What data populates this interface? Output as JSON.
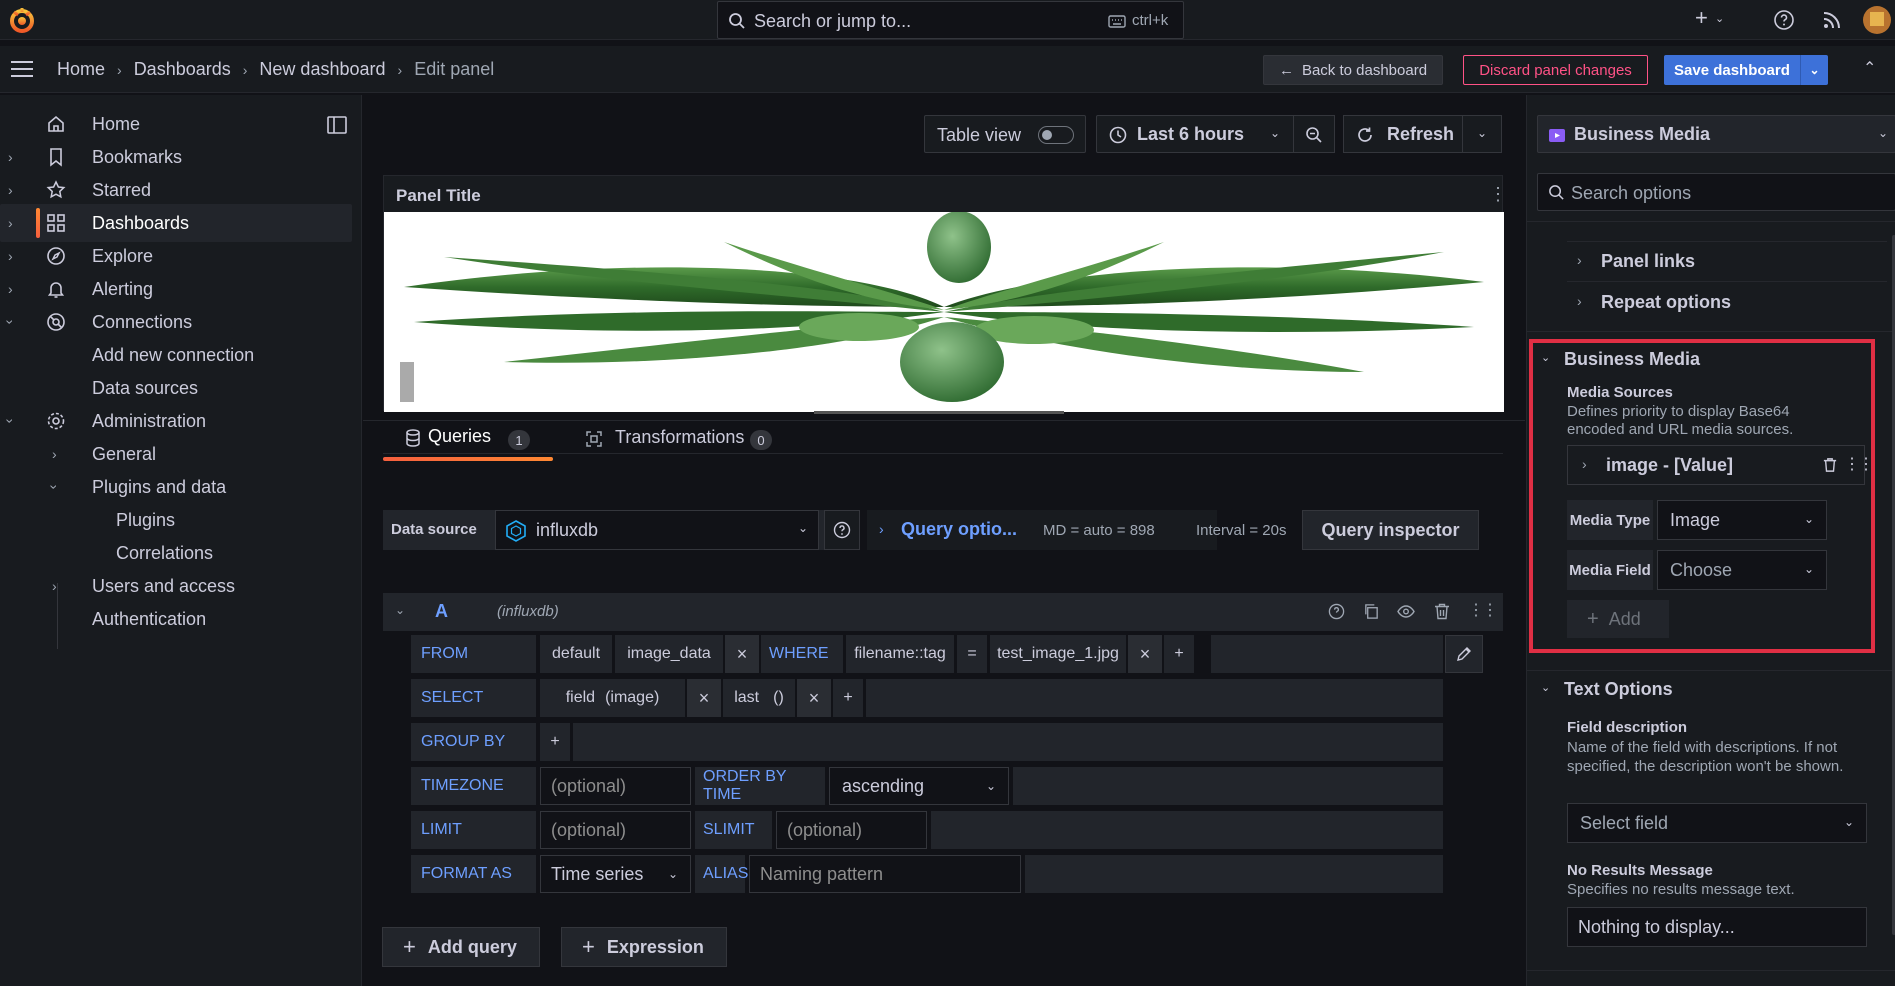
{
  "topbar": {
    "search_placeholder": "Search or jump to...",
    "search_shortcut": "ctrl+k"
  },
  "breadcrumb": {
    "items": [
      "Home",
      "Dashboards",
      "New dashboard",
      "Edit panel"
    ]
  },
  "actions": {
    "back": "Back to dashboard",
    "discard": "Discard panel changes",
    "save": "Save dashboard"
  },
  "sidebar": {
    "items": [
      {
        "label": "Home"
      },
      {
        "label": "Bookmarks"
      },
      {
        "label": "Starred"
      },
      {
        "label": "Dashboards"
      },
      {
        "label": "Explore"
      },
      {
        "label": "Alerting"
      },
      {
        "label": "Connections"
      },
      {
        "label": "Add new connection"
      },
      {
        "label": "Data sources"
      },
      {
        "label": "Administration"
      },
      {
        "label": "General"
      },
      {
        "label": "Plugins and data"
      },
      {
        "label": "Plugins"
      },
      {
        "label": "Correlations"
      },
      {
        "label": "Users and access"
      },
      {
        "label": "Authentication"
      }
    ]
  },
  "toolbar": {
    "table_view": "Table view",
    "time_range": "Last 6 hours",
    "refresh": "Refresh"
  },
  "panel": {
    "title": "Panel Title"
  },
  "tabs": {
    "queries": "Queries",
    "queries_count": "1",
    "transformations": "Transformations",
    "transformations_count": "0"
  },
  "datasource": {
    "label": "Data source",
    "value": "influxdb",
    "query_options": "Query optio...",
    "md": "MD = auto = 898",
    "interval": "Interval = 20s",
    "inspector": "Query inspector"
  },
  "query": {
    "ref": "A",
    "source": "(influxdb)",
    "from_label": "FROM",
    "from_policy": "default",
    "from_measurement": "image_data",
    "where_label": "WHERE",
    "where_key": "filename::tag",
    "where_op": "=",
    "where_value": "test_image_1.jpg",
    "plus": "+",
    "select_label": "SELECT",
    "select_field": "field",
    "select_field_arg": "(image)",
    "select_fn": "last",
    "select_fn_arg": "()",
    "groupby_label": "GROUP BY",
    "timezone_label": "TIMEZONE",
    "timezone_placeholder": "(optional)",
    "orderby_label": "ORDER BY TIME",
    "orderby_value": "ascending",
    "limit_label": "LIMIT",
    "limit_placeholder": "(optional)",
    "slimit_label": "SLIMIT",
    "slimit_placeholder": "(optional)",
    "format_label": "FORMAT AS",
    "format_value": "Time series",
    "alias_label": "ALIAS",
    "alias_placeholder": "Naming pattern"
  },
  "bottom": {
    "add_query": "Add query",
    "expression": "Expression"
  },
  "options": {
    "viz": "Business Media",
    "search_placeholder": "Search options",
    "panel_links": "Panel links",
    "repeat_options": "Repeat options",
    "section_title": "Business Media",
    "media_sources_title": "Media Sources",
    "media_sources_desc": "Defines priority to display Base64 encoded and URL media sources.",
    "source_item": "image - [Value]",
    "media_type_label": "Media Type",
    "media_type_value": "Image",
    "media_field_label": "Media Field",
    "media_field_value": "Choose",
    "add": "Add",
    "text_options": "Text Options",
    "field_desc_title": "Field description",
    "field_desc_text": "Name of the field with descriptions. If not specified, the description won't be shown.",
    "select_field": "Select field",
    "no_results_title": "No Results Message",
    "no_results_desc": "Specifies no results message text.",
    "no_results_value": "Nothing to display..."
  },
  "colors": {
    "accent": "#f55f3e",
    "primary": "#3d71d9",
    "danger": "#ff5286",
    "highlight": "#e02f44"
  }
}
